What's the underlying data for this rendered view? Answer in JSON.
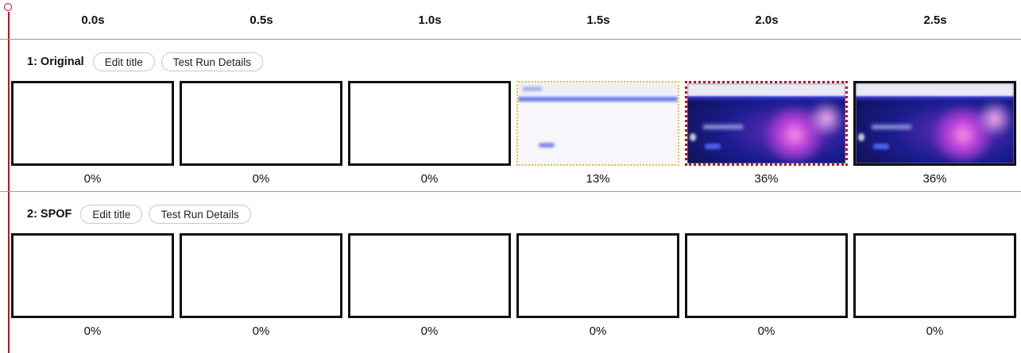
{
  "timeline": [
    "0.0s",
    "0.5s",
    "1.0s",
    "1.5s",
    "2.0s",
    "2.5s"
  ],
  "runs": [
    {
      "title": "1: Original",
      "edit_label": "Edit title",
      "details_label": "Test Run Details",
      "frames": [
        {
          "progress": "0%",
          "state": "blank"
        },
        {
          "progress": "0%",
          "state": "blank"
        },
        {
          "progress": "0%",
          "state": "blank"
        },
        {
          "progress": "13%",
          "state": "visual-change-light"
        },
        {
          "progress": "36%",
          "state": "visual-change-dark"
        },
        {
          "progress": "36%",
          "state": "dark"
        }
      ]
    },
    {
      "title": "2: SPOF",
      "edit_label": "Edit title",
      "details_label": "Test Run Details",
      "frames": [
        {
          "progress": "0%",
          "state": "blank"
        },
        {
          "progress": "0%",
          "state": "blank"
        },
        {
          "progress": "0%",
          "state": "blank"
        },
        {
          "progress": "0%",
          "state": "blank"
        },
        {
          "progress": "0%",
          "state": "blank"
        },
        {
          "progress": "0%",
          "state": "blank"
        }
      ]
    }
  ],
  "colors": {
    "timeline_marker": "#d0021b",
    "first_visual_change_border": "#f5b82e",
    "key_change_border": "#c4001d"
  }
}
